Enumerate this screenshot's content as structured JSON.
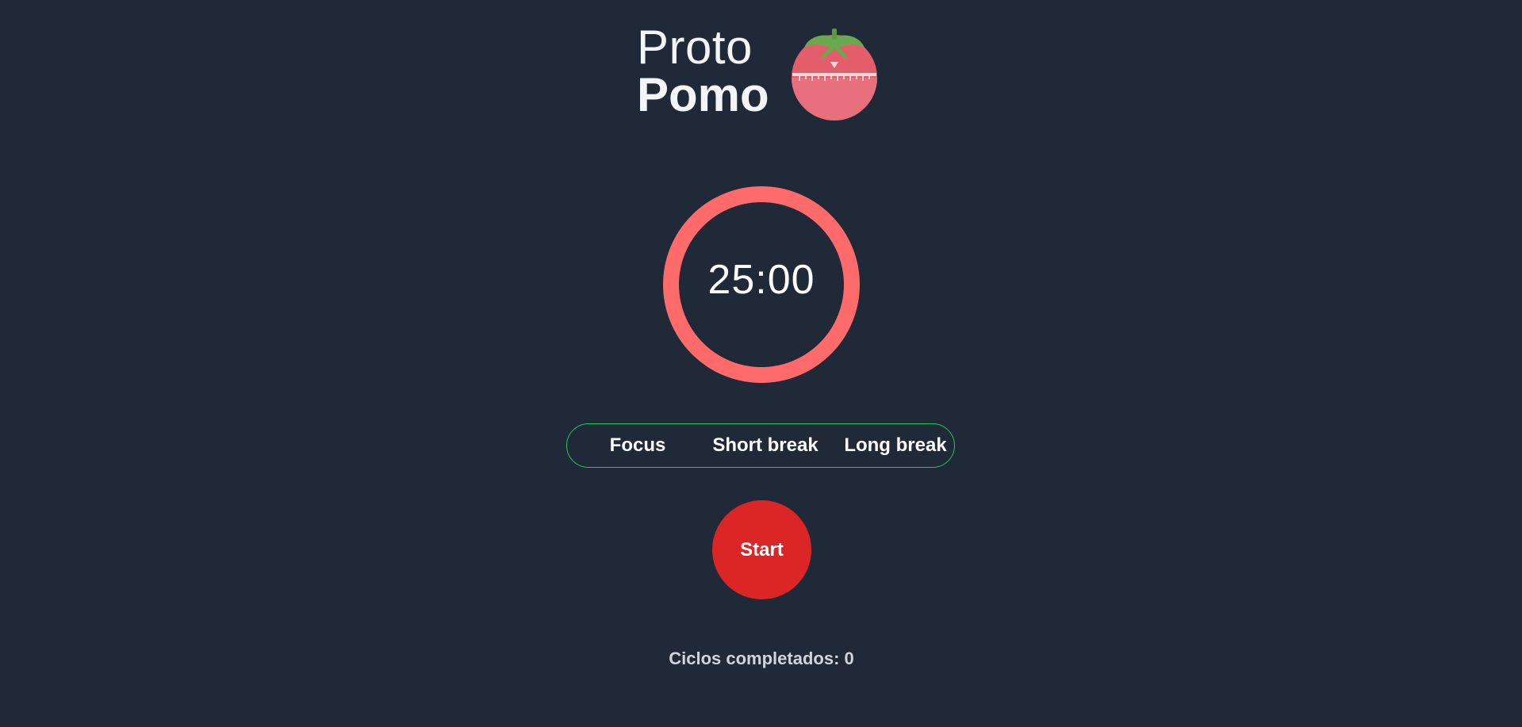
{
  "header": {
    "title_light": "Proto",
    "title_bold": "Pomo",
    "logo_icon": "tomato-timer-icon"
  },
  "timer": {
    "display": "25:00",
    "progress": 1.0,
    "ring_color": "#ff6b6b"
  },
  "modes": {
    "focus_label": "Focus",
    "short_break_label": "Short break",
    "long_break_label": "Long break",
    "border_color": "#22c55e"
  },
  "controls": {
    "start_label": "Start",
    "start_color": "#dc2626"
  },
  "footer": {
    "cycles_text": "Ciclos completados: 0"
  },
  "theme": {
    "background": "#202938",
    "text": "#f3f4f6"
  }
}
